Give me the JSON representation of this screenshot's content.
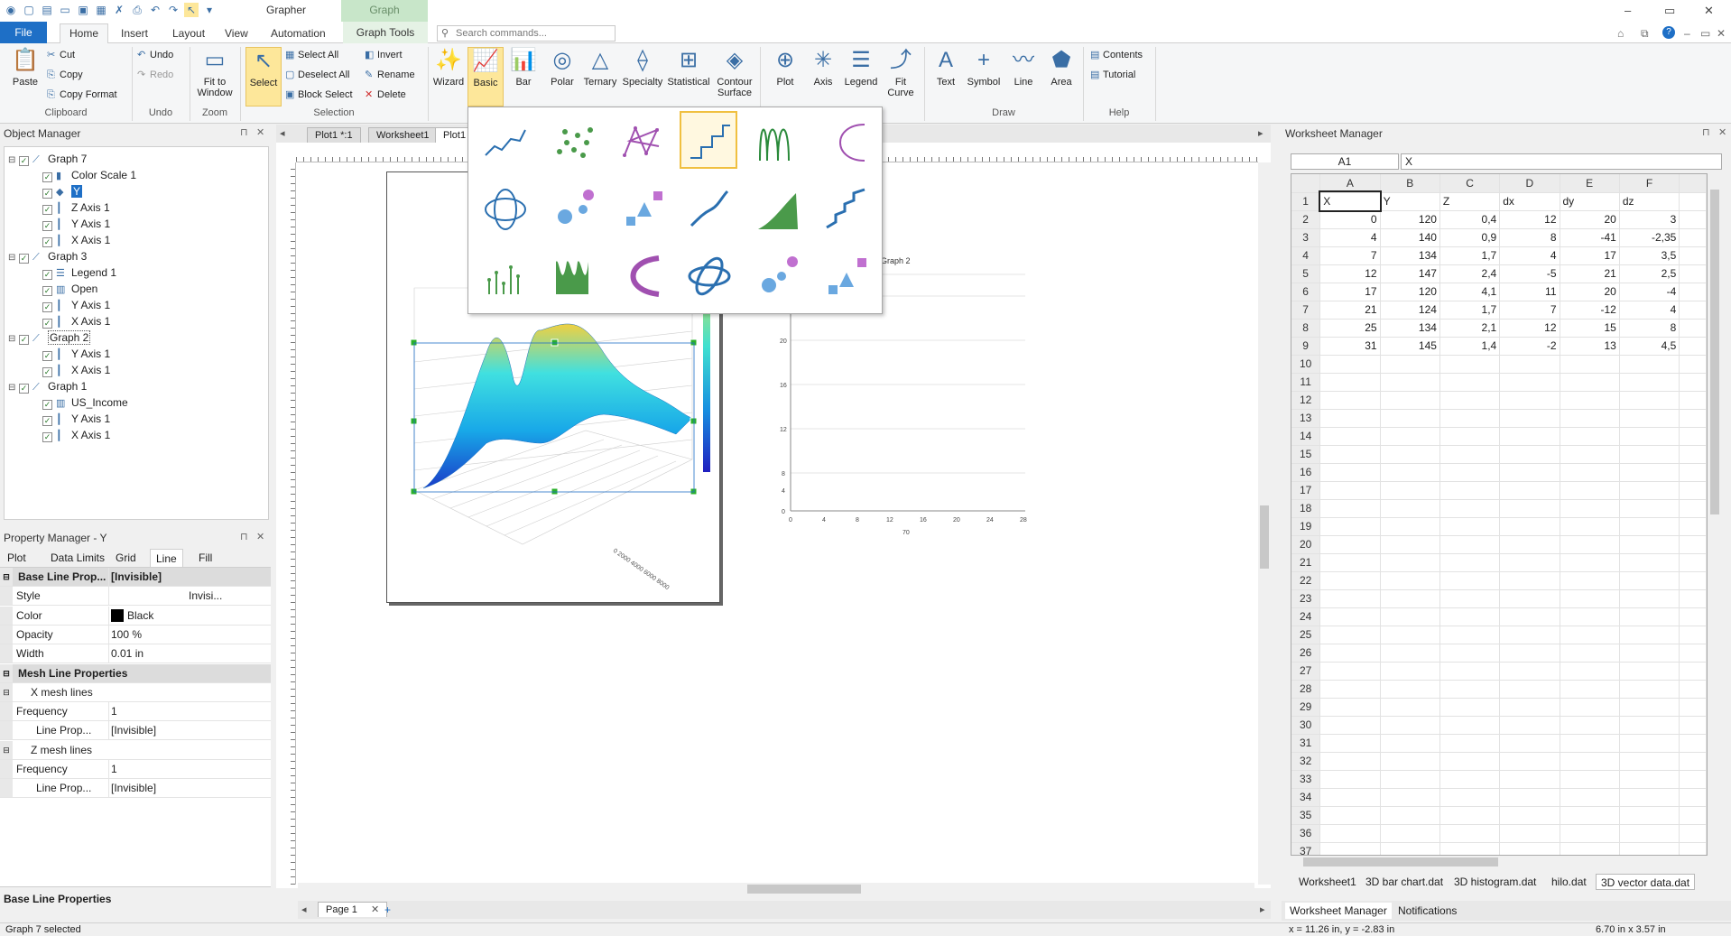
{
  "app": {
    "title": "Grapher",
    "context_tab_title": "Graph",
    "window_controls": [
      "–",
      "▭",
      "✕"
    ],
    "help_controls": [
      "⌂",
      "⧉",
      "?",
      "–",
      "▭",
      "✕"
    ]
  },
  "ribbon_tabs": [
    "File",
    "Home",
    "Insert",
    "Layout",
    "View",
    "Automation",
    "Graph Tools"
  ],
  "search": {
    "placeholder": "Search commands..."
  },
  "ribbon": {
    "clipboard": {
      "label": "Clipboard",
      "paste": "Paste",
      "cut": "Cut",
      "copy": "Copy",
      "copy_format": "Copy Format"
    },
    "undo": {
      "label": "Undo",
      "undo": "Undo",
      "redo": "Redo"
    },
    "zoom": {
      "label": "Zoom",
      "fit_to_window_1": "Fit to",
      "fit_to_window_2": "Window"
    },
    "selection": {
      "label": "Selection",
      "select": "Select",
      "select_all": "Select All",
      "deselect_all": "Deselect All",
      "block_select": "Block Select",
      "invert": "Invert",
      "rename": "Rename",
      "delete": "Delete"
    },
    "graph": {
      "wizard": "Wizard",
      "basic": "Basic",
      "bar": "Bar",
      "polar": "Polar",
      "ternary": "Ternary",
      "specialty": "Specialty",
      "statistical": "Statistical",
      "contour_1": "Contour",
      "contour_2": "Surface"
    },
    "add": {
      "plot": "Plot",
      "axis": "Axis",
      "legend": "Legend",
      "fit_curve_1": "Fit",
      "fit_curve_2": "Curve"
    },
    "draw": {
      "label": "Draw",
      "text": "Text",
      "symbol": "Symbol",
      "line": "Line",
      "area": "Area"
    },
    "help": {
      "label": "Help",
      "contents": "Contents",
      "tutorial": "Tutorial"
    }
  },
  "object_manager": {
    "title": "Object Manager",
    "items": [
      {
        "label": "Graph 7",
        "level": 0,
        "icon": "graph-icon"
      },
      {
        "label": "Color Scale 1",
        "level": 1,
        "icon": "color-scale-icon"
      },
      {
        "label": "Y",
        "level": 1,
        "icon": "surface-plot-icon"
      },
      {
        "label": "Z Axis 1",
        "level": 1,
        "icon": "axis-icon"
      },
      {
        "label": "Y Axis 1",
        "level": 1,
        "icon": "axis-icon"
      },
      {
        "label": "X Axis 1",
        "level": 1,
        "icon": "axis-icon"
      },
      {
        "label": "Graph 3",
        "level": 0,
        "icon": "graph-icon"
      },
      {
        "label": "Legend 1",
        "level": 1,
        "icon": "legend-icon"
      },
      {
        "label": "Open",
        "level": 1,
        "icon": "bar-plot-icon"
      },
      {
        "label": "Y Axis 1",
        "level": 1,
        "icon": "axis-icon"
      },
      {
        "label": "X Axis 1",
        "level": 1,
        "icon": "axis-icon"
      },
      {
        "label": "Graph 2",
        "level": 0,
        "icon": "graph-icon"
      },
      {
        "label": "Y Axis 1",
        "level": 1,
        "icon": "axis-icon"
      },
      {
        "label": "X Axis 1",
        "level": 1,
        "icon": "axis-icon"
      },
      {
        "label": "Graph 1",
        "level": 0,
        "icon": "graph-icon"
      },
      {
        "label": "US_Income",
        "level": 1,
        "icon": "bar-plot-icon"
      },
      {
        "label": "Y Axis 1",
        "level": 1,
        "icon": "axis-icon"
      },
      {
        "label": "X Axis 1",
        "level": 1,
        "icon": "axis-icon"
      }
    ]
  },
  "property_manager": {
    "title": "Property Manager - Y",
    "tabs": [
      "Plot",
      "Data Limits",
      "Grid",
      "Line",
      "Fill"
    ],
    "active_tab": "Line",
    "rows": [
      {
        "type": "section",
        "key": "Base Line Prop...",
        "value": "[Invisible]"
      },
      {
        "type": "row",
        "key": "Style",
        "value": "Invisi..."
      },
      {
        "type": "row",
        "key": "Color",
        "value": "Black"
      },
      {
        "type": "row",
        "key": "Opacity",
        "value": "100 %"
      },
      {
        "type": "row",
        "key": "Width",
        "value": "0.01 in"
      },
      {
        "type": "section",
        "key": "Mesh Line Properties",
        "value": ""
      },
      {
        "type": "sub",
        "key": "X mesh lines",
        "value": ""
      },
      {
        "type": "row",
        "key": "Frequency",
        "value": "1"
      },
      {
        "type": "row",
        "key": "Line Prop...",
        "value": "[Invisible]"
      },
      {
        "type": "sub",
        "key": "Z mesh lines",
        "value": ""
      },
      {
        "type": "row",
        "key": "Frequency",
        "value": "1"
      },
      {
        "type": "row",
        "key": "Line Prop...",
        "value": "[Invisible]"
      }
    ],
    "description": "Base Line Properties"
  },
  "document": {
    "tabs": [
      "Plot1 *:1",
      "Worksheet1",
      "Plot1"
    ],
    "page_tab": "Page 1",
    "graph2_label": "Graph 2",
    "graph2_axis_label": "70",
    "graph2_x_ticks": [
      "0",
      "4",
      "8",
      "12",
      "16",
      "20",
      "24",
      "28"
    ],
    "graph2_y_ticks": [
      "20",
      "16",
      "12",
      "8",
      "4",
      "0"
    ]
  },
  "worksheet_manager": {
    "title": "Worksheet Manager",
    "cell_ref": "A1",
    "formula": "X",
    "columns": [
      "A",
      "B",
      "C",
      "D",
      "E",
      "F"
    ],
    "rows": [
      [
        "X",
        "Y",
        "Z",
        "dx",
        "dy",
        "dz"
      ],
      [
        "0",
        "120",
        "0,4",
        "12",
        "20",
        "3"
      ],
      [
        "4",
        "140",
        "0,9",
        "8",
        "-41",
        "-2,35"
      ],
      [
        "7",
        "134",
        "1,7",
        "4",
        "17",
        "3,5"
      ],
      [
        "12",
        "147",
        "2,4",
        "-5",
        "21",
        "2,5"
      ],
      [
        "17",
        "120",
        "4,1",
        "11",
        "20",
        "-4"
      ],
      [
        "21",
        "124",
        "1,7",
        "7",
        "-12",
        "4"
      ],
      [
        "25",
        "134",
        "2,1",
        "12",
        "15",
        "8"
      ],
      [
        "31",
        "145",
        "1,4",
        "-2",
        "13",
        "4,5"
      ]
    ],
    "row_numbers": [
      "1",
      "2",
      "3",
      "4",
      "5",
      "6",
      "7",
      "8",
      "9",
      "10",
      "11",
      "12",
      "13",
      "14",
      "15",
      "16",
      "17",
      "18",
      "19",
      "20",
      "21",
      "22",
      "23",
      "24",
      "25",
      "26",
      "27",
      "28",
      "29",
      "30",
      "31",
      "32",
      "33",
      "34",
      "35",
      "36",
      "37"
    ],
    "sheet_tabs": [
      "Worksheet1",
      "3D bar chart.dat",
      "3D histogram.dat",
      "hilo.dat",
      "3D vector data.dat"
    ],
    "active_sheet": "3D vector data.dat",
    "bottom_tabs": [
      "Worksheet Manager",
      "Notifications"
    ]
  },
  "status": {
    "left": "Graph 7 selected",
    "coords": "x = 11.26 in, y = -2.83 in",
    "size": "6.70 in x 3.57 in"
  },
  "colors": {
    "accent": "#1e6fc6",
    "selected_button": "#fde79a",
    "context_tab": "#c8e6c9"
  }
}
